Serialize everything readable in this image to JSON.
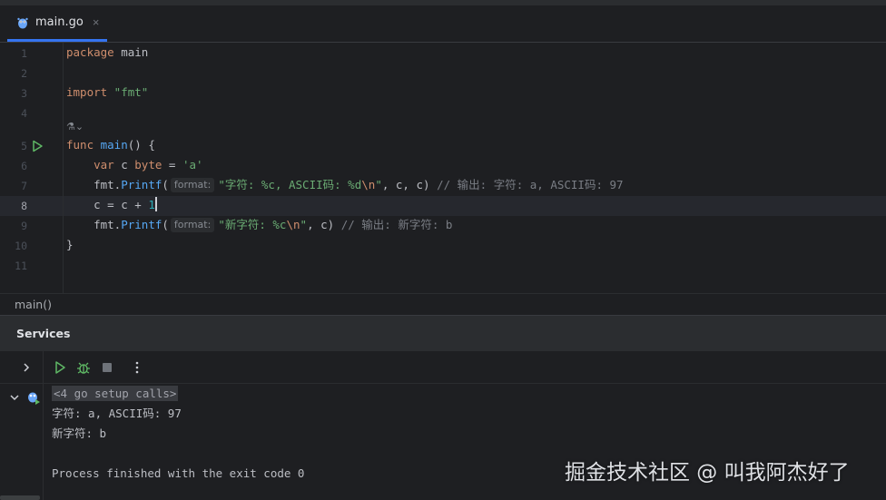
{
  "tab": {
    "label": "main.go",
    "close": "×"
  },
  "gutter": {
    "lines": [
      "1",
      "2",
      "3",
      "4",
      "5",
      "6",
      "7",
      "8",
      "9",
      "10",
      "11"
    ]
  },
  "code": {
    "l1_kw": "package",
    "l1_rest": " main",
    "l3_kw": "import",
    "l3_str": " \"fmt\"",
    "l5_kw": "func",
    "l5_fn": " main",
    "l5_rest": "() {",
    "l6_indent": "    ",
    "l6_kw": "var",
    "l6_mid": " c ",
    "l6_kw2": "byte",
    "l6_eq": " = ",
    "l6_str": "'a'",
    "l7_call": "    fmt.",
    "l7_fn": "Printf",
    "l7_paren": "(",
    "l7_hint": "format:",
    "l7_str1": "\"字符: %c, ASCII码: %d",
    "l7_esc": "\\n",
    "l7_str2": "\"",
    "l7_args": ", c, c) ",
    "l7_cmt": "// 输出: 字符: a, ASCII码: 97",
    "l8_text": "    c = c + ",
    "l8_num": "1",
    "l9_call": "    fmt.",
    "l9_fn": "Printf",
    "l9_paren": "(",
    "l9_hint": "format:",
    "l9_str1": "\"新字符: %c",
    "l9_esc": "\\n",
    "l9_str2": "\"",
    "l9_args": ", c) ",
    "l9_cmt": "// 输出: 新字符: b",
    "l10_text": "}"
  },
  "lens": "⚗⌄",
  "breadcrumb": "main()",
  "services": {
    "title": "Services",
    "console": {
      "setup": "<4 go setup calls>",
      "line1": "字符: a, ASCII码: 97",
      "line2": "新字符: b",
      "line3": "Process finished with the exit code 0"
    }
  },
  "watermark": "掘金技术社区 @ 叫我阿杰好了",
  "colors": {
    "accent": "#3574f0",
    "run_green": "#5fb865",
    "keyword": "#cf8e6d",
    "function": "#56a8f5",
    "string": "#6aab73"
  }
}
